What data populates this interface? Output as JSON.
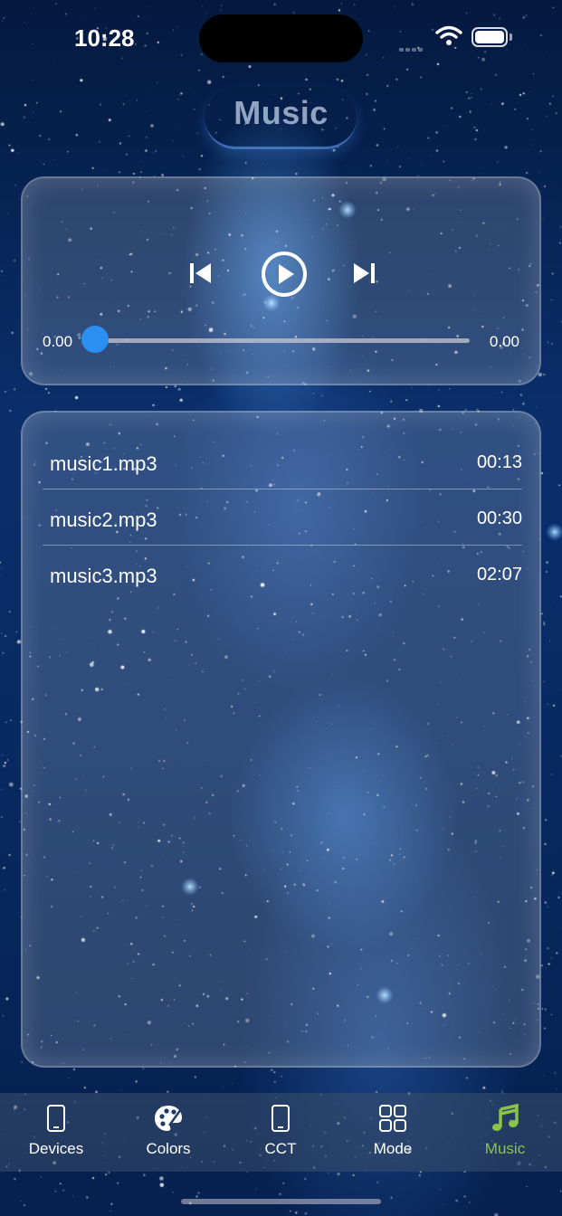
{
  "status_bar": {
    "time": "10:28"
  },
  "header": {
    "title": "Music"
  },
  "player": {
    "current_time": "0.00",
    "total_time": "0.00",
    "progress": 0.0
  },
  "playlist": [
    {
      "name": "music1.mp3",
      "duration": "00:13"
    },
    {
      "name": "music2.mp3",
      "duration": "00:30"
    },
    {
      "name": "music3.mp3",
      "duration": "02:07"
    }
  ],
  "tabbar": {
    "items": [
      {
        "label": "Devices",
        "icon": "phone-icon"
      },
      {
        "label": "Colors",
        "icon": "palette-icon"
      },
      {
        "label": "CCT",
        "icon": "phone-icon"
      },
      {
        "label": "Mode",
        "icon": "grid-icon"
      },
      {
        "label": "Music",
        "icon": "music-note-icon",
        "active": true
      }
    ]
  },
  "colors": {
    "accent": "#2a8ff0",
    "active_tab": "#8bc34a"
  }
}
